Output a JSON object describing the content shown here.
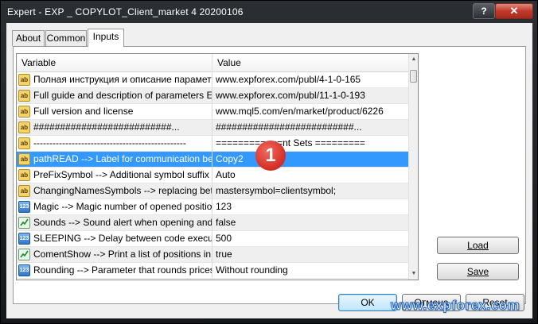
{
  "window": {
    "title": "Expert - EXP _ COPYLOT_Client_market 4 20200106",
    "help_label": "?",
    "close_label": "✕"
  },
  "tabs": [
    {
      "label": "About"
    },
    {
      "label": "Common"
    },
    {
      "label": "Inputs",
      "active": true
    }
  ],
  "grid": {
    "col_variable": "Variable",
    "col_value": "Value",
    "rows": [
      {
        "icon": "ab",
        "variable": "Полная инструкция и описание параметр...",
        "value": "www.expforex.com/publ/4-1-0-165"
      },
      {
        "icon": "ab",
        "variable": "Full guide and description of parameters Eng",
        "value": "www.expforex.com/publ/11-1-0-193"
      },
      {
        "icon": "ab",
        "variable": "Full version and license",
        "value": "www.mql5.com/en/market/product/6226"
      },
      {
        "icon": "ab",
        "variable": "##########################...",
        "value": "##########################..."
      },
      {
        "icon": "ab",
        "variable": "------------------------------------------------",
        "value": "============nt Sets ========="
      },
      {
        "icon": "ab",
        "variable": "pathREAD --> Label for communication betw...",
        "value": "Copy2",
        "selected": true
      },
      {
        "icon": "ab",
        "variable": "PreFixSymbol --> Additional symbol suffix",
        "value": "Auto"
      },
      {
        "icon": "ab",
        "variable": "ChangingNamesSymbols --> replacing betwe...",
        "value": "mastersymbol=clientsymbol;"
      },
      {
        "icon": "num",
        "variable": "Magic --> Magic number of opened positions ...",
        "value": "123"
      },
      {
        "icon": "bool",
        "variable": "Sounds --> Sound alert when opening and cl...",
        "value": "false"
      },
      {
        "icon": "num",
        "variable": "SLEEPING --> Delay between code executio...",
        "value": "500"
      },
      {
        "icon": "bool",
        "variable": "ComentShow --> Print a list of positions in the...",
        "value": "true"
      },
      {
        "icon": "num",
        "variable": "Rounding --> Parameter that rounds prices w...",
        "value": "Without rounding"
      }
    ]
  },
  "icons": {
    "ab": "ab",
    "num": "123"
  },
  "buttons": {
    "load": "Load",
    "save": "Save",
    "ok": "OK",
    "cancel": "Отмена",
    "reset": "Reset"
  },
  "annotation_badge": "1",
  "watermark": "www.expforex.com"
}
